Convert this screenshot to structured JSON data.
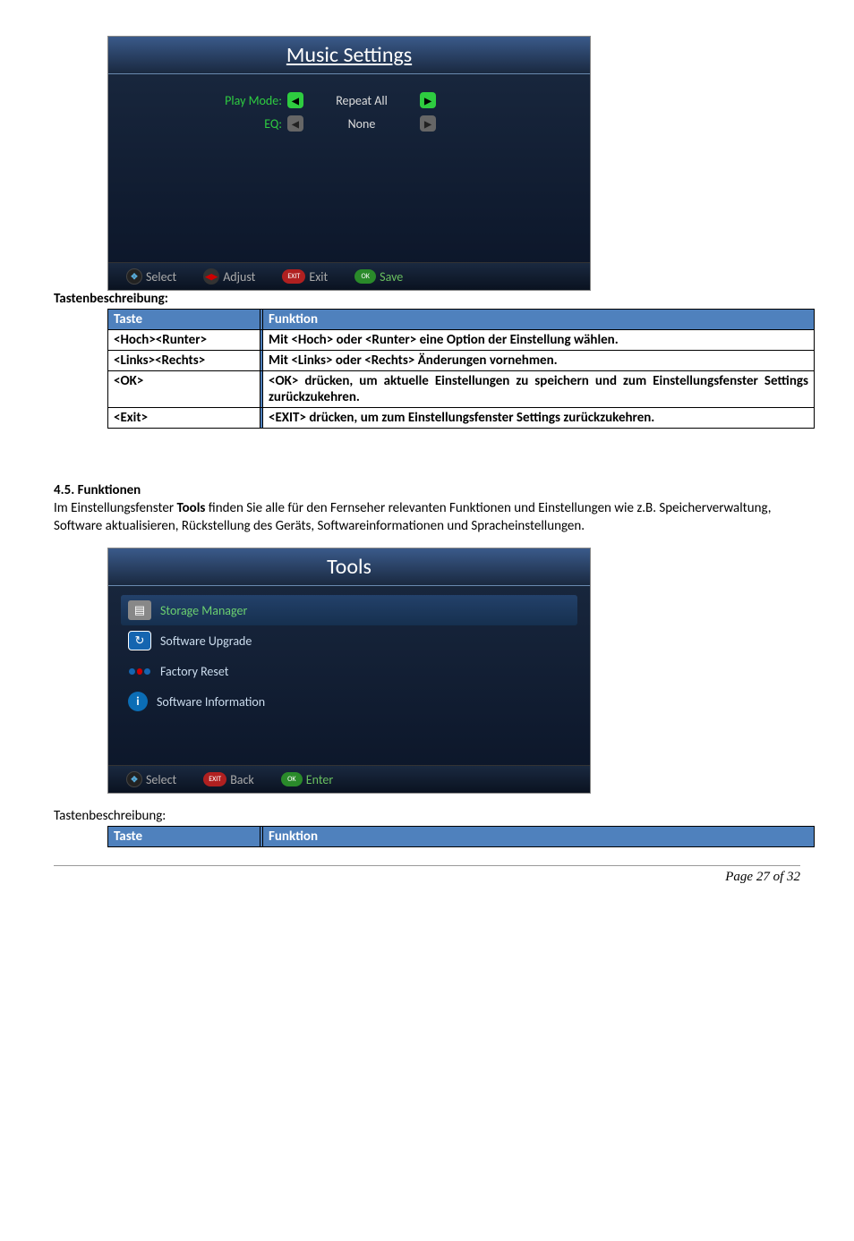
{
  "screenshot1": {
    "title": "Music Settings",
    "rows": [
      {
        "label": "Play Mode:",
        "value": "Repeat All",
        "selected": true
      },
      {
        "label": "EQ:",
        "value": "None",
        "selected": false
      }
    ],
    "footer": {
      "select": "Select",
      "adjust": "Adjust",
      "exit": "Exit",
      "save": "Save"
    }
  },
  "label_tastenbeschreibung": "Tastenbeschreibung:",
  "table1": {
    "th_taste": "Taste",
    "th_funktion": "Funktion",
    "rows": [
      {
        "taste": "<Hoch><Runter>",
        "funktion": "Mit <Hoch> oder <Runter> eine Option der Einstellung wählen."
      },
      {
        "taste": "<Links><Rechts>",
        "funktion": "Mit <Links> oder <Rechts> Änderungen vornehmen."
      },
      {
        "taste": "<OK>",
        "funktion": "<OK> drücken, um aktuelle Einstellungen zu speichern und zum Einstellungsfenster Settings zurückzukehren."
      },
      {
        "taste": "<Exit>",
        "funktion": "<EXIT> drücken, um zum Einstellungsfenster Settings zurückzukehren."
      }
    ]
  },
  "section45": {
    "heading": "4.5. Funktionen",
    "p1a": "Im Einstellungsfenster ",
    "p1b": "Tools",
    "p1c": " finden Sie alle für den Fernseher relevanten Funktionen und Einstellungen wie z.B. Speicherverwaltung, Software aktualisieren, Rückstellung des Geräts, Softwareinformationen und Spracheinstellungen."
  },
  "screenshot2": {
    "title": "Tools",
    "items": [
      {
        "label": "Storage Manager",
        "icon": "storage",
        "selected": true
      },
      {
        "label": "Software Upgrade",
        "icon": "upgrade",
        "selected": false
      },
      {
        "label": "Factory Reset",
        "icon": "reset",
        "selected": false
      },
      {
        "label": "Software Information",
        "icon": "info",
        "selected": false
      }
    ],
    "footer": {
      "select": "Select",
      "back": "Back",
      "enter": "Enter"
    }
  },
  "table2": {
    "th_taste": "Taste",
    "th_funktion": "Funktion"
  },
  "page_footer": "Page 27 of 32"
}
